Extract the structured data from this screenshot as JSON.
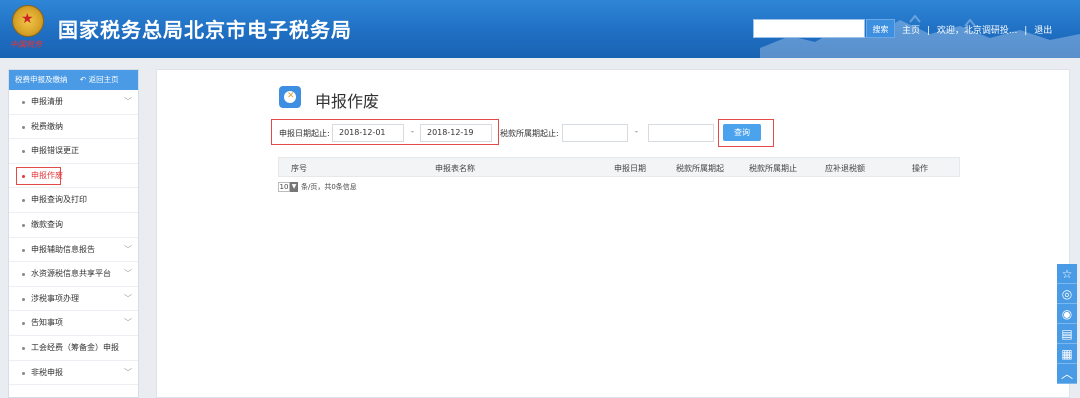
{
  "header": {
    "title": "国家税务总局北京市电子税务局",
    "emblem_seal_text": "中国税务",
    "search": {
      "value": "",
      "button_label": "搜索"
    },
    "links": [
      "主页",
      "|",
      "欢迎，北京调研投...",
      "|",
      "退出"
    ]
  },
  "sidebar": {
    "head_label": "税费申报及缴纳",
    "back_label": "返回主页",
    "items": [
      {
        "label": "申报清册",
        "has_children": true
      },
      {
        "label": "税费缴纳",
        "has_children": false
      },
      {
        "label": "申报错误更正",
        "has_children": false
      },
      {
        "label": "申报作废",
        "has_children": false,
        "active": true
      },
      {
        "label": "申报查询及打印",
        "has_children": false
      },
      {
        "label": "缴款查询",
        "has_children": false
      },
      {
        "label": "申报辅助信息报告",
        "has_children": true
      },
      {
        "label": "水资源税信息共享平台",
        "has_children": true
      },
      {
        "label": "涉税事项办理",
        "has_children": true
      },
      {
        "label": "告知事项",
        "has_children": true
      },
      {
        "label": "工会经费（筹备金）申报",
        "has_children": false
      },
      {
        "label": "非税申报",
        "has_children": true
      }
    ]
  },
  "main": {
    "page_title": "申报作废",
    "filter": {
      "declare_date_label": "申报日期起止:",
      "declare_date_from": "2018-12-01",
      "declare_date_to": "2018-12-19",
      "tax_period_label": "税款所属期起止:",
      "tax_period_from": "",
      "tax_period_to": "",
      "separator": "-",
      "query_button": "查询"
    },
    "table": {
      "columns": [
        "序号",
        "申报表名称",
        "申报日期",
        "税款所属期起",
        "税款所属期止",
        "应补退税额",
        "操作"
      ],
      "rows": []
    },
    "pager": {
      "page_size": "10",
      "info": "条/页，共0条信息"
    }
  },
  "colors": {
    "header_bg": "#1f6fc3",
    "sidebar_head": "#4a9ae6",
    "highlight_box": "#e34b4b",
    "query_button": "#4ba3ee",
    "active_text": "#e03a3a"
  },
  "float_tools": [
    "star-icon",
    "coin-icon",
    "weibo-icon",
    "message-icon",
    "document-icon",
    "up-arrow-icon"
  ]
}
